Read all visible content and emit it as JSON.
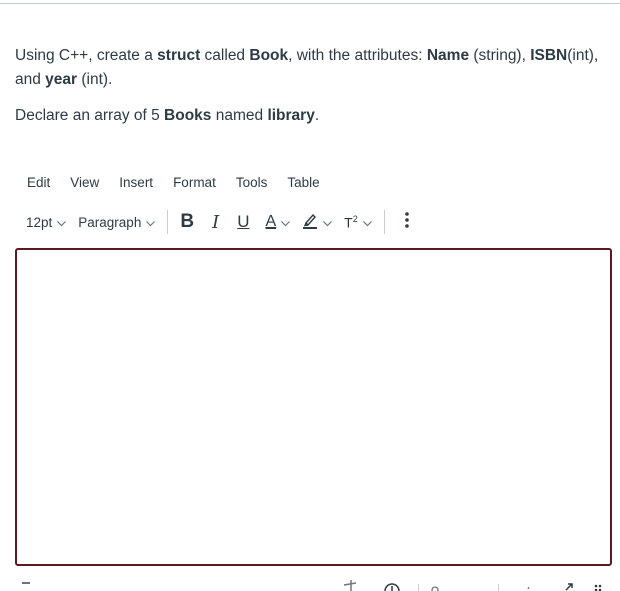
{
  "question": {
    "p1": {
      "t1": "Using C++, create a ",
      "b1": "struct",
      "t2": " called ",
      "b2": "Book",
      "t3": ", with the attributes: ",
      "b3": "Name",
      "t4": " (string), ",
      "b4": "ISBN",
      "t5": "(int), and ",
      "b5": "year",
      "t6": " (int)."
    },
    "p2": {
      "t1": "Declare an array of 5 ",
      "b1": "Books",
      "t2": " named ",
      "b2": "library",
      "t3": "."
    }
  },
  "menubar": [
    "Edit",
    "View",
    "Insert",
    "Format",
    "Tools",
    "Table"
  ],
  "toolbar": {
    "font_size": "12pt",
    "block_format": "Paragraph",
    "bold": "B",
    "italic": "I",
    "underline": "U",
    "text_color": "A",
    "superscript_base": "T",
    "superscript_exp": "2"
  },
  "colors": {
    "text": "#2d3b45",
    "editor_border": "#5c1a1f",
    "separator": "#c7cdd1"
  }
}
